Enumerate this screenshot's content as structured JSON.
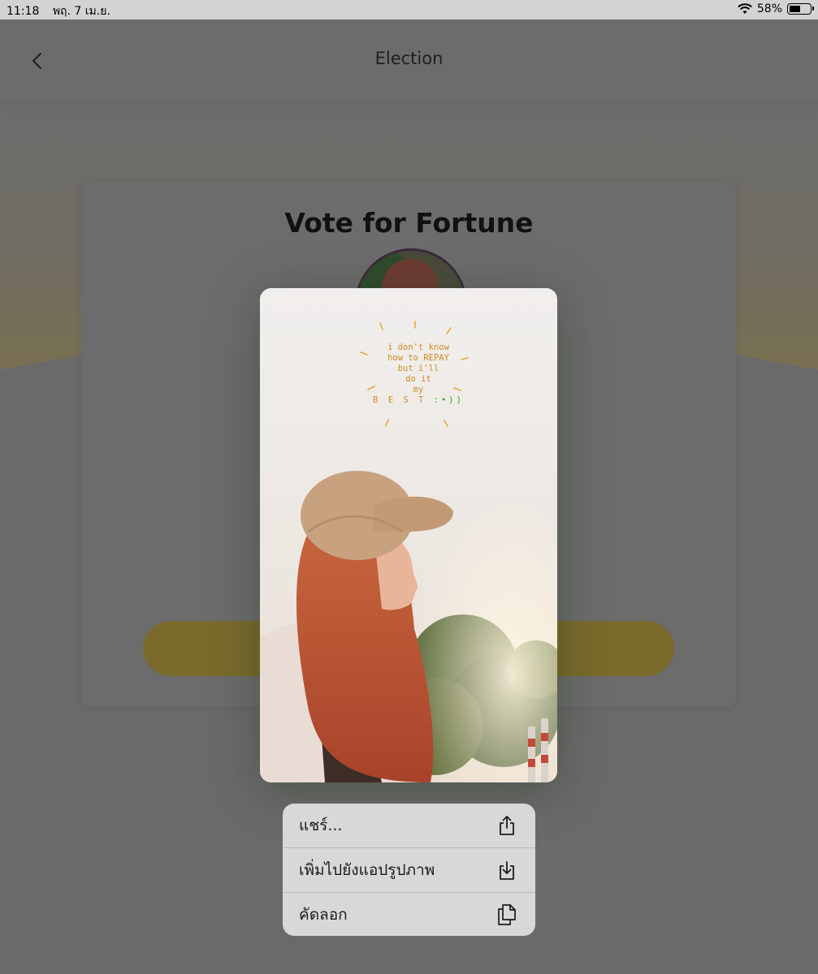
{
  "status_bar": {
    "time": "11:18",
    "date": "พฤ. 7 เม.ย.",
    "battery": "58%",
    "battery_level": 0.58
  },
  "nav": {
    "title": "Election",
    "back_icon": "chevron-left-icon"
  },
  "card": {
    "title": "Vote for Fortune"
  },
  "preview": {
    "quote_lines": [
      "i don't know",
      "how to REPAY",
      "but i'll",
      "do it",
      "my",
      "B E S T"
    ],
    "smiley": ":•))"
  },
  "context_menu": {
    "items": [
      {
        "label": "แชร์...",
        "icon": "share-icon"
      },
      {
        "label": "เพิ่มไปยังแอปรูปภาพ",
        "icon": "save-to-photos-icon"
      },
      {
        "label": "คัดลอก",
        "icon": "copy-icon"
      }
    ]
  },
  "colors": {
    "overlay_dim": "#6b6b6b",
    "accent_gold": "#7a6a2c",
    "menu_bg": "#d8d8d8",
    "quote_orange": "#d08a28"
  }
}
